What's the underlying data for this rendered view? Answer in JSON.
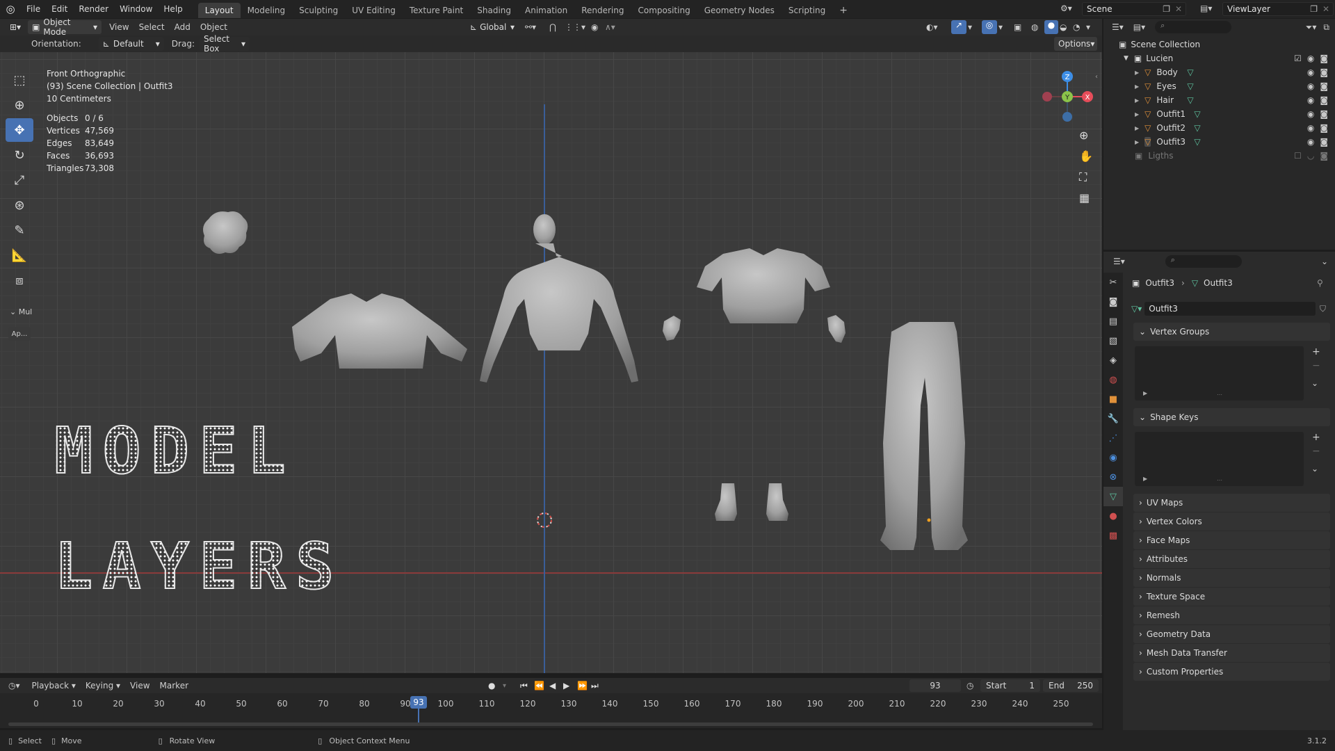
{
  "menubar": {
    "items": [
      "File",
      "Edit",
      "Render",
      "Window",
      "Help"
    ],
    "workspaces": [
      "Layout",
      "Modeling",
      "Sculpting",
      "UV Editing",
      "Texture Paint",
      "Shading",
      "Animation",
      "Rendering",
      "Compositing",
      "Geometry Nodes",
      "Scripting"
    ],
    "active_workspace": "Layout",
    "add_tab": "+",
    "scene": "Scene",
    "view_layer": "ViewLayer"
  },
  "viewport_header": {
    "mode": "Object Mode",
    "menus": [
      "View",
      "Select",
      "Add",
      "Object"
    ],
    "transform_orientation": "Global",
    "orientation_label": "Orientation:",
    "orientation_value": "Default",
    "drag_label": "Drag:",
    "drag_value": "Select Box",
    "options": "Options"
  },
  "viewport": {
    "view_name": "Front Orthographic",
    "collection": "(93) Scene Collection | Outfit3",
    "scale": "10 Centimeters",
    "stats": [
      {
        "label": "Objects",
        "value": "0 / 6"
      },
      {
        "label": "Vertices",
        "value": "47,569"
      },
      {
        "label": "Edges",
        "value": "83,649"
      },
      {
        "label": "Faces",
        "value": "36,693"
      },
      {
        "label": "Triangles",
        "value": "73,308"
      }
    ],
    "title_line1": "MODEL",
    "title_line2": "LAYERS",
    "panel_label": "Mul",
    "apply_label": "Ap...",
    "gizmo": {
      "z": "Z",
      "y": "Y",
      "x": "X"
    }
  },
  "outliner": {
    "root": "Scene Collection",
    "collection": "Lucien",
    "objects": [
      "Body",
      "Eyes",
      "Hair",
      "Outfit1",
      "Outfit2",
      "Outfit3"
    ],
    "other_collection": "Ligths"
  },
  "properties": {
    "breadcrumb_object": "Outfit3",
    "breadcrumb_data": "Outfit3",
    "data_name": "Outfit3",
    "open_panels": [
      "Vertex Groups",
      "Shape Keys"
    ],
    "closed_panels": [
      "UV Maps",
      "Vertex Colors",
      "Face Maps",
      "Attributes",
      "Normals",
      "Texture Space",
      "Remesh",
      "Geometry Data",
      "Mesh Data Transfer",
      "Custom Properties"
    ]
  },
  "timeline": {
    "menus": [
      "Playback",
      "Keying",
      "View",
      "Marker"
    ],
    "current_frame": "93",
    "start_label": "Start",
    "start": "1",
    "end_label": "End",
    "end": "250",
    "ticks": [
      "0",
      "10",
      "20",
      "30",
      "40",
      "50",
      "60",
      "70",
      "80",
      "90",
      "100",
      "110",
      "120",
      "130",
      "140",
      "150",
      "160",
      "170",
      "180",
      "190",
      "200",
      "210",
      "220",
      "230",
      "240",
      "250"
    ],
    "playhead": "93"
  },
  "statusbar": {
    "items": [
      "Select",
      "Move",
      "Rotate View",
      "Object Context Menu"
    ],
    "version": "3.1.2"
  },
  "colors": {
    "accent": "#4772b3",
    "x_axis": "#e64d5a",
    "y_axis": "#8bc34a",
    "z_axis": "#3d8ee6",
    "mesh_icon": "#5ec4a0",
    "object_icon": "#e0913a"
  }
}
